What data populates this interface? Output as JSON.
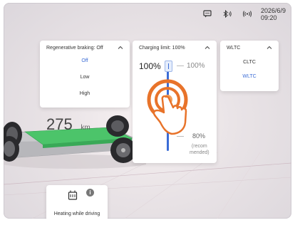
{
  "status_bar": {
    "date": "2026/6/9",
    "time": "09:20",
    "icons": [
      "message-icon",
      "bluetooth-icon",
      "wireless-signal-icon"
    ]
  },
  "range": {
    "value": "275",
    "unit": "km"
  },
  "regen_braking": {
    "title": "Regenerative braking: Off",
    "options": [
      "Off",
      "Low",
      "High"
    ],
    "selected": "Off"
  },
  "charging_limit": {
    "title": "Charging limit: 100%",
    "current_value": "100%",
    "max_label": "100%",
    "recommended_label": "80%",
    "recommended_note_line1": "(recom",
    "recommended_note_line2": "mended)",
    "level_percent": 100
  },
  "cycle": {
    "title": "WLTC",
    "options": [
      "CLTC",
      "WLTC"
    ],
    "selected": "WLTC"
  },
  "heating_card": {
    "label": "Heating while driving",
    "info_icon": "info-icon",
    "icon": "seat-heater-icon"
  },
  "colors": {
    "accent": "#3b6cd6",
    "touch_orange": "#e8732a",
    "battery_green": "#4cc46a"
  }
}
